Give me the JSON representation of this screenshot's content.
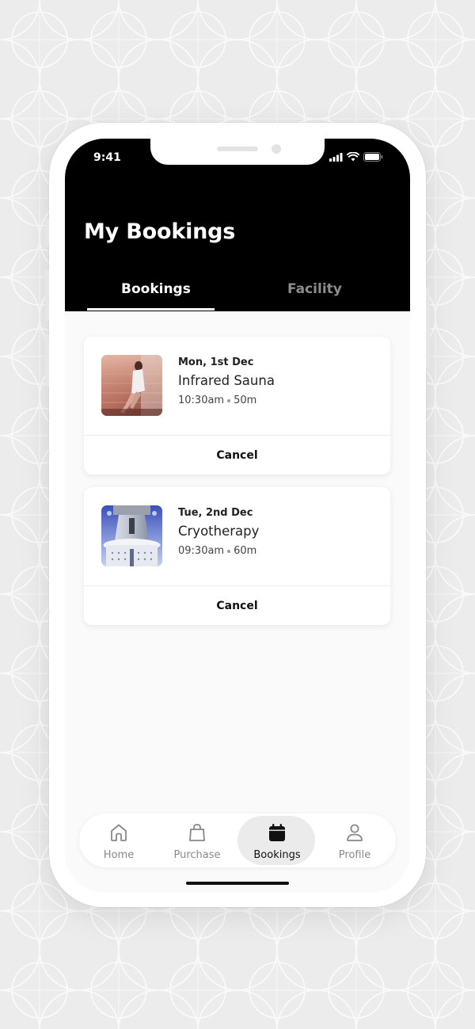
{
  "status_bar": {
    "time": "9:41"
  },
  "header": {
    "title": "My Bookings"
  },
  "tabs": [
    {
      "label": "Bookings",
      "active": true
    },
    {
      "label": "Facility",
      "active": false
    }
  ],
  "bookings": [
    {
      "date": "Mon, 1st Dec",
      "title": "Infrared Sauna",
      "time": "10:30am",
      "duration": "50m",
      "cancel_label": "Cancel",
      "image": "sauna-photo"
    },
    {
      "date": "Tue, 2nd Dec",
      "title": "Cryotherapy",
      "time": "09:30am",
      "duration": "60m",
      "cancel_label": "Cancel",
      "image": "cryotherapy-chamber-photo"
    }
  ],
  "nav": [
    {
      "label": "Home",
      "icon": "home-icon",
      "active": false
    },
    {
      "label": "Purchase",
      "icon": "shopping-bag-icon",
      "active": false
    },
    {
      "label": "Bookings",
      "icon": "calendar-icon",
      "active": true
    },
    {
      "label": "Profile",
      "icon": "person-icon",
      "active": false
    }
  ],
  "colors": {
    "header_bg": "#000000",
    "accent": "#000000",
    "screen_bg": "#fafafa",
    "inactive_text": "#888888"
  }
}
